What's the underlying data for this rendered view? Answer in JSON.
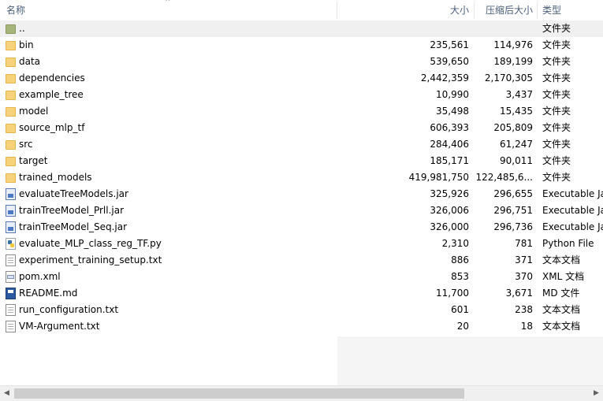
{
  "header": {
    "name": "名称",
    "size": "大小",
    "compressed": "压缩后大小",
    "type": "类型",
    "sort_indicator": "^"
  },
  "rows": [
    {
      "icon": "folder-up-icon",
      "name": "..",
      "size": "",
      "compressed": "",
      "type": "文件夹"
    },
    {
      "icon": "folder-icon",
      "name": "bin",
      "size": "235,561",
      "compressed": "114,976",
      "type": "文件夹"
    },
    {
      "icon": "folder-icon",
      "name": "data",
      "size": "539,650",
      "compressed": "189,199",
      "type": "文件夹"
    },
    {
      "icon": "folder-icon",
      "name": "dependencies",
      "size": "2,442,359",
      "compressed": "2,170,305",
      "type": "文件夹"
    },
    {
      "icon": "folder-icon",
      "name": "example_tree",
      "size": "10,990",
      "compressed": "3,437",
      "type": "文件夹"
    },
    {
      "icon": "folder-icon",
      "name": "model",
      "size": "35,498",
      "compressed": "15,435",
      "type": "文件夹"
    },
    {
      "icon": "folder-icon",
      "name": "source_mlp_tf",
      "size": "606,393",
      "compressed": "205,809",
      "type": "文件夹"
    },
    {
      "icon": "folder-icon",
      "name": "src",
      "size": "284,406",
      "compressed": "61,247",
      "type": "文件夹"
    },
    {
      "icon": "folder-icon",
      "name": "target",
      "size": "185,171",
      "compressed": "90,011",
      "type": "文件夹"
    },
    {
      "icon": "folder-icon",
      "name": "trained_models",
      "size": "419,981,750",
      "compressed": "122,485,6...",
      "type": "文件夹"
    },
    {
      "icon": "jar-file-icon",
      "name": "evaluateTreeModels.jar",
      "size": "325,926",
      "compressed": "296,655",
      "type": "Executable Ja"
    },
    {
      "icon": "jar-file-icon",
      "name": "trainTreeModel_Prll.jar",
      "size": "326,006",
      "compressed": "296,751",
      "type": "Executable Ja"
    },
    {
      "icon": "jar-file-icon",
      "name": "trainTreeModel_Seq.jar",
      "size": "326,000",
      "compressed": "296,736",
      "type": "Executable Ja"
    },
    {
      "icon": "python-file-icon",
      "name": "evaluate_MLP_class_reg_TF.py",
      "size": "2,310",
      "compressed": "781",
      "type": "Python File"
    },
    {
      "icon": "text-file-icon",
      "name": "experiment_training_setup.txt",
      "size": "886",
      "compressed": "371",
      "type": "文本文档"
    },
    {
      "icon": "xml-file-icon",
      "name": "pom.xml",
      "size": "853",
      "compressed": "370",
      "type": "XML 文档"
    },
    {
      "icon": "markdown-file-icon",
      "name": "README.md",
      "size": "11,700",
      "compressed": "3,671",
      "type": "MD 文件"
    },
    {
      "icon": "text-file-icon",
      "name": "run_configuration.txt",
      "size": "601",
      "compressed": "238",
      "type": "文本文档"
    },
    {
      "icon": "text-file-icon",
      "name": "VM-Argument.txt",
      "size": "20",
      "compressed": "18",
      "type": "文本文档"
    }
  ],
  "scrollbar": {
    "left_arrow": "◀",
    "right_arrow": "▶"
  },
  "colors": {
    "header_text": "#4c607a",
    "folder": "#f6d37a",
    "selected_row": "#f0f0f0"
  }
}
